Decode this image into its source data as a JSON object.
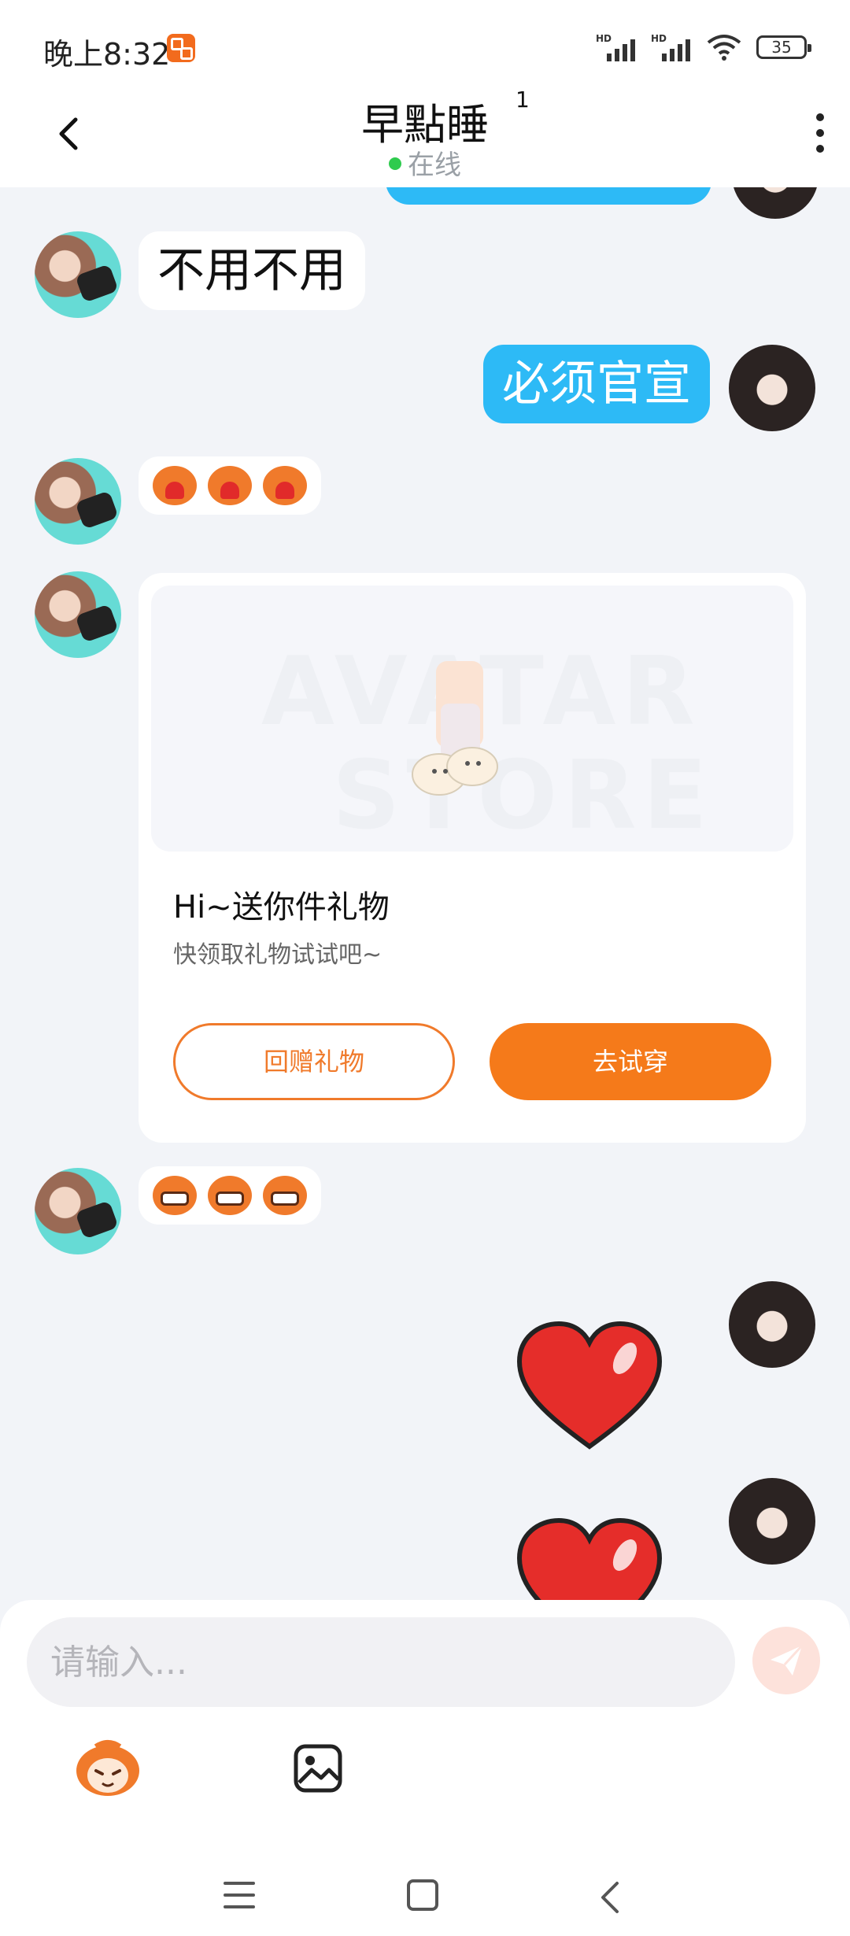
{
  "status_bar": {
    "time": "晚上8:32",
    "signal1_label": "HD",
    "signal2_label": "HD",
    "battery": "35"
  },
  "header": {
    "title": "早點睡",
    "title_superscript": "1",
    "status": "在线"
  },
  "messages": [
    {
      "from": "other",
      "type": "text",
      "text": "不用不用"
    },
    {
      "from": "me",
      "type": "text",
      "text": "必须官宣"
    },
    {
      "from": "other",
      "type": "emoji",
      "emoji": [
        "heart-hug-emoji",
        "heart-hug-emoji",
        "heart-hug-emoji"
      ]
    },
    {
      "from": "other",
      "type": "gift_card",
      "image_watermark": [
        "AVATAR",
        "STORE"
      ],
      "title": "Hi~送你件礼物",
      "subtitle": "快领取礼物试试吧~",
      "return_gift_label": "回赠礼物",
      "try_on_label": "去试穿"
    },
    {
      "from": "other",
      "type": "emoji",
      "emoji": [
        "grin-emoji",
        "grin-emoji",
        "grin-emoji"
      ]
    },
    {
      "from": "me",
      "type": "sticker",
      "sticker": "red-heart-sticker"
    },
    {
      "from": "me",
      "type": "sticker",
      "sticker": "red-heart-sticker"
    }
  ],
  "input": {
    "placeholder": "请输入..."
  },
  "colors": {
    "outgoing_bubble": "#2dbaf6",
    "incoming_bubble": "#ffffff",
    "accent": "#f57a1a",
    "online_dot": "#2fcb4e",
    "background": "#f2f4f8"
  }
}
